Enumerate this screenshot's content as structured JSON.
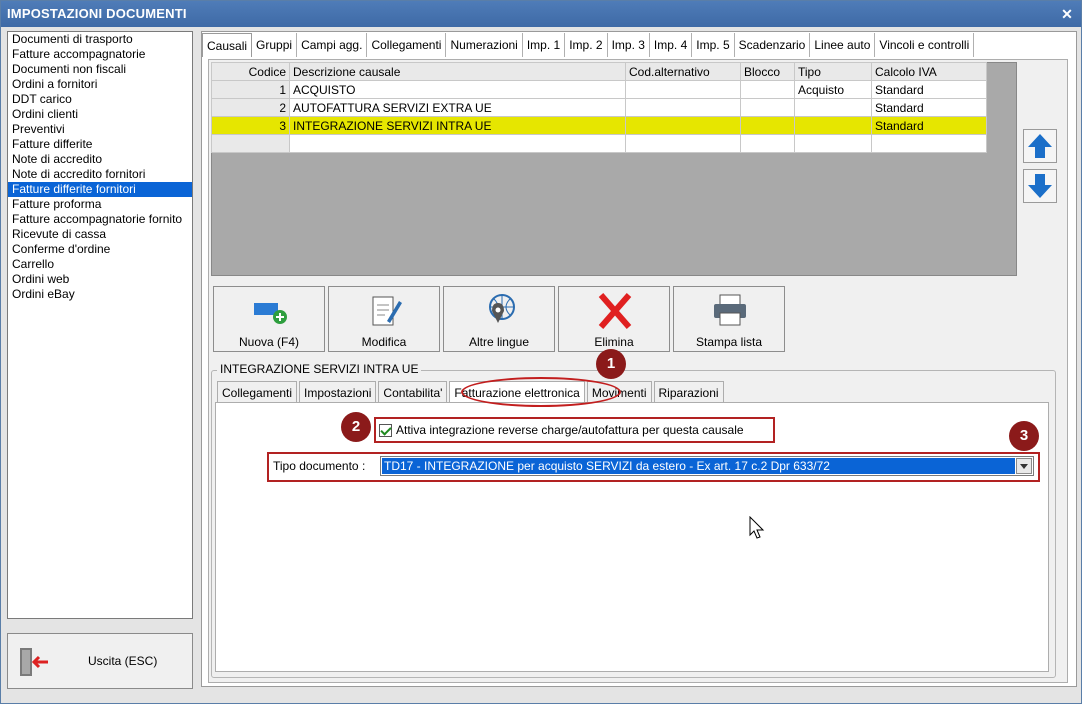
{
  "window": {
    "title": "IMPOSTAZIONI DOCUMENTI",
    "close_glyph": "✕"
  },
  "doclist": {
    "items": [
      "Documenti di trasporto",
      "Fatture accompagnatorie",
      "Documenti non fiscali",
      "Ordini a fornitori",
      "DDT carico",
      "Ordini clienti",
      "Preventivi",
      "Fatture differite",
      "Note di accredito",
      "Note di accredito fornitori",
      "Fatture differite fornitori",
      "Fatture proforma",
      "Fatture accompagnatorie fornito",
      "Ricevute di cassa",
      "Conferme d'ordine",
      "Carrello",
      "Ordini web",
      "Ordini eBay"
    ],
    "selected_index": 10
  },
  "exit_button": {
    "label": "Uscita (ESC)",
    "icon": "exit-door-icon"
  },
  "top_tabs": [
    "Causali",
    "Gruppi",
    "Campi agg.",
    "Collegamenti",
    "Numerazioni",
    "Imp. 1",
    "Imp. 2",
    "Imp. 3",
    "Imp. 4",
    "Imp. 5",
    "Scadenzario",
    "Linee auto",
    "Vincoli e controlli"
  ],
  "active_top_tab": 0,
  "grid": {
    "headers": [
      "Codice",
      "Descrizione causale",
      "Cod.alternativo",
      "Blocco",
      "Tipo",
      "Calcolo IVA"
    ],
    "rows": [
      [
        "1",
        "ACQUISTO",
        "",
        "",
        "Acquisto",
        "Standard"
      ],
      [
        "2",
        "AUTOFATTURA SERVIZI EXTRA UE",
        "",
        "",
        "",
        "Standard"
      ],
      [
        "3",
        "INTEGRAZIONE SERVIZI INTRA UE",
        "",
        "",
        "",
        "Standard"
      ],
      [
        "",
        "",
        "",
        "",
        "",
        ""
      ]
    ],
    "highlighted_row": 2,
    "highlight_color": "#e6e600"
  },
  "arrows": {
    "up_icon": "arrow-up-icon",
    "down_icon": "arrow-down-icon"
  },
  "toolbar": [
    {
      "label": "Nuova (F4)",
      "icon": "new-item-icon"
    },
    {
      "label": "Modifica",
      "icon": "edit-document-icon"
    },
    {
      "label": "Altre lingue",
      "icon": "globe-location-icon"
    },
    {
      "label": "Elimina",
      "icon": "delete-x-icon"
    },
    {
      "label": "Stampa lista",
      "icon": "printer-icon"
    }
  ],
  "group": {
    "title": "INTEGRAZIONE SERVIZI INTRA UE",
    "tabs": [
      "Collegamenti",
      "Impostazioni",
      "Contabilita'",
      "Fatturazione elettronica",
      "Movimenti",
      "Riparazioni"
    ],
    "active_tab": 3
  },
  "form": {
    "checkbox_label": "Attiva integrazione reverse charge/autofattura per questa causale",
    "checkbox_checked": true,
    "tipo_label": "Tipo documento :",
    "tipo_value": "TD17 - INTEGRAZIONE per acquisto SERVIZI da estero - Ex art. 17 c.2 Dpr 633/72"
  },
  "markers": [
    "1",
    "2",
    "3"
  ],
  "colors": {
    "accent": "#0a64d6",
    "marker": "#8b1a1a",
    "annotation": "#b22222"
  }
}
